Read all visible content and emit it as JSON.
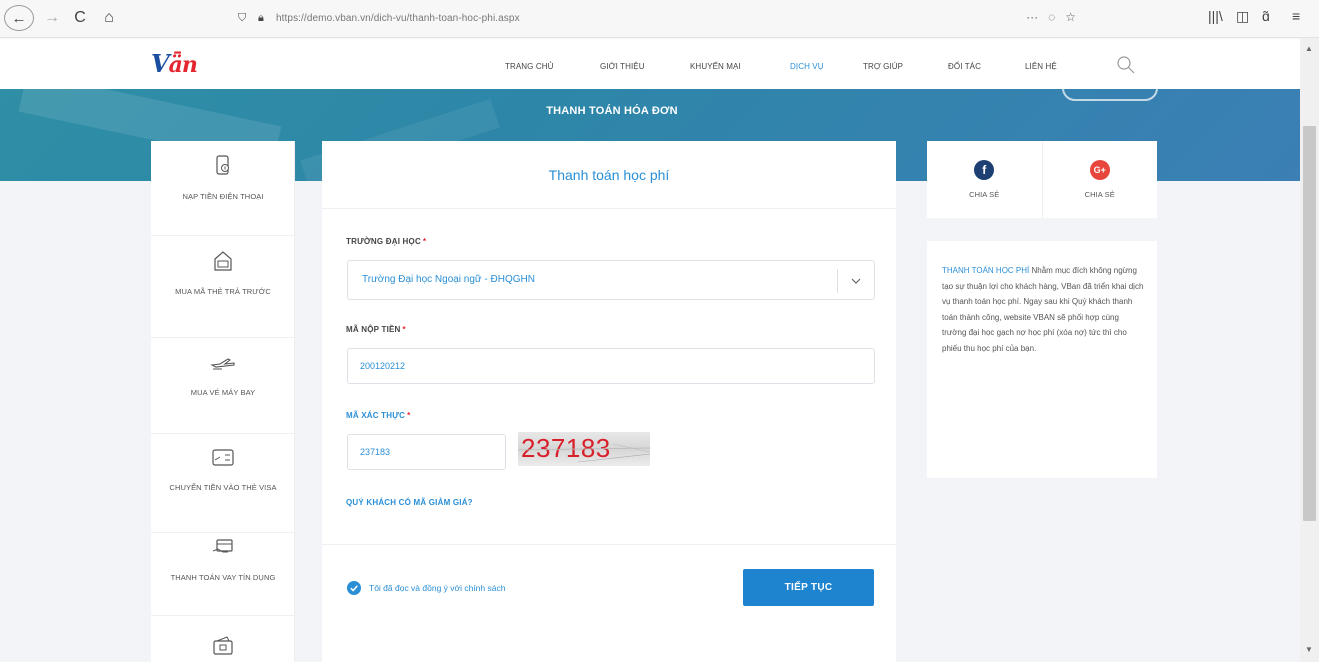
{
  "browser": {
    "back": "←",
    "forward": "→",
    "reload": "C",
    "home": "⌂",
    "url": "https://demo.vban.vn/dich-vu/thanh-toan-hoc-phi.aspx",
    "more": "···",
    "pocket": "◌",
    "star": "☆",
    "library": "|||\\",
    "sidebar_toggle": "◫",
    "extension": "ɑ̃",
    "menu": "≡"
  },
  "site": {
    "logo_v": "V",
    "logo_ban": "ǟn",
    "nav": [
      "TRANG CHỦ",
      "GIỚI THIỆU",
      "KHUYẾN MẠI",
      "DỊCH VỤ",
      "TRỢ GIÚP",
      "ĐỐI TÁC",
      "LIÊN HỆ"
    ],
    "active_nav": "DỊCH VỤ",
    "banner_title": "THANH TOÁN HÓA ĐƠN"
  },
  "sidebar": {
    "items": [
      {
        "label": "NẠP TIỀN ĐIỆN THOẠI",
        "icon": "phone-topup-icon"
      },
      {
        "label": "MUA MÃ THẺ TRẢ TRƯỚC",
        "icon": "prepaid-card-icon"
      },
      {
        "label": "MUA VÉ MÁY BAY",
        "icon": "airplane-icon"
      },
      {
        "label": "CHUYỂN TIỀN VÀO THẺ VISA",
        "icon": "visa-card-icon"
      },
      {
        "label": "THANH TOÁN VAY TÍN DỤNG",
        "icon": "credit-loan-icon"
      }
    ]
  },
  "form": {
    "title": "Thanh toán học phí",
    "university_label": "TRƯỜNG ĐẠI HỌC",
    "university_value": "Trường Đại học Ngoại ngữ - ĐHQGHN",
    "payment_code_label": "MÃ NỘP TIỀN",
    "payment_code_value": "200120212",
    "captcha_label": "MÃ XÁC THỰC",
    "captcha_value": "237183",
    "captcha_image_text": "237183",
    "required_mark": "*",
    "discount_link": "QUÝ KHÁCH CÓ MÃ GIẢM GIÁ?",
    "agree_text": "Tôi đã đọc và đồng ý với chính sách",
    "agree_checked": true,
    "submit_label": "TIẾP TỤC"
  },
  "share": {
    "facebook_label": "CHIA SẺ",
    "google_label": "CHIA SẺ",
    "facebook_glyph": "f",
    "google_glyph": "G+"
  },
  "info": {
    "highlight": "THANH TOÁN HỌC PHÍ",
    "body": " Nhằm mục đích không ngừng tạo sự thuận lợi cho khách hàng, VBan đã triển khai dịch vụ thanh toán học phí. Ngay sau khi Quý khách thanh toán thành công, website VBAN sẽ phối hợp cùng trường đại học gạch nợ học phí (xóa nợ) tức thì cho phiếu thu học phí của bạn."
  },
  "colors": {
    "accent": "#2a8fd6",
    "button": "#1f84cf",
    "required": "#e3262f",
    "facebook": "#1d3f72",
    "google": "#e8453c"
  }
}
